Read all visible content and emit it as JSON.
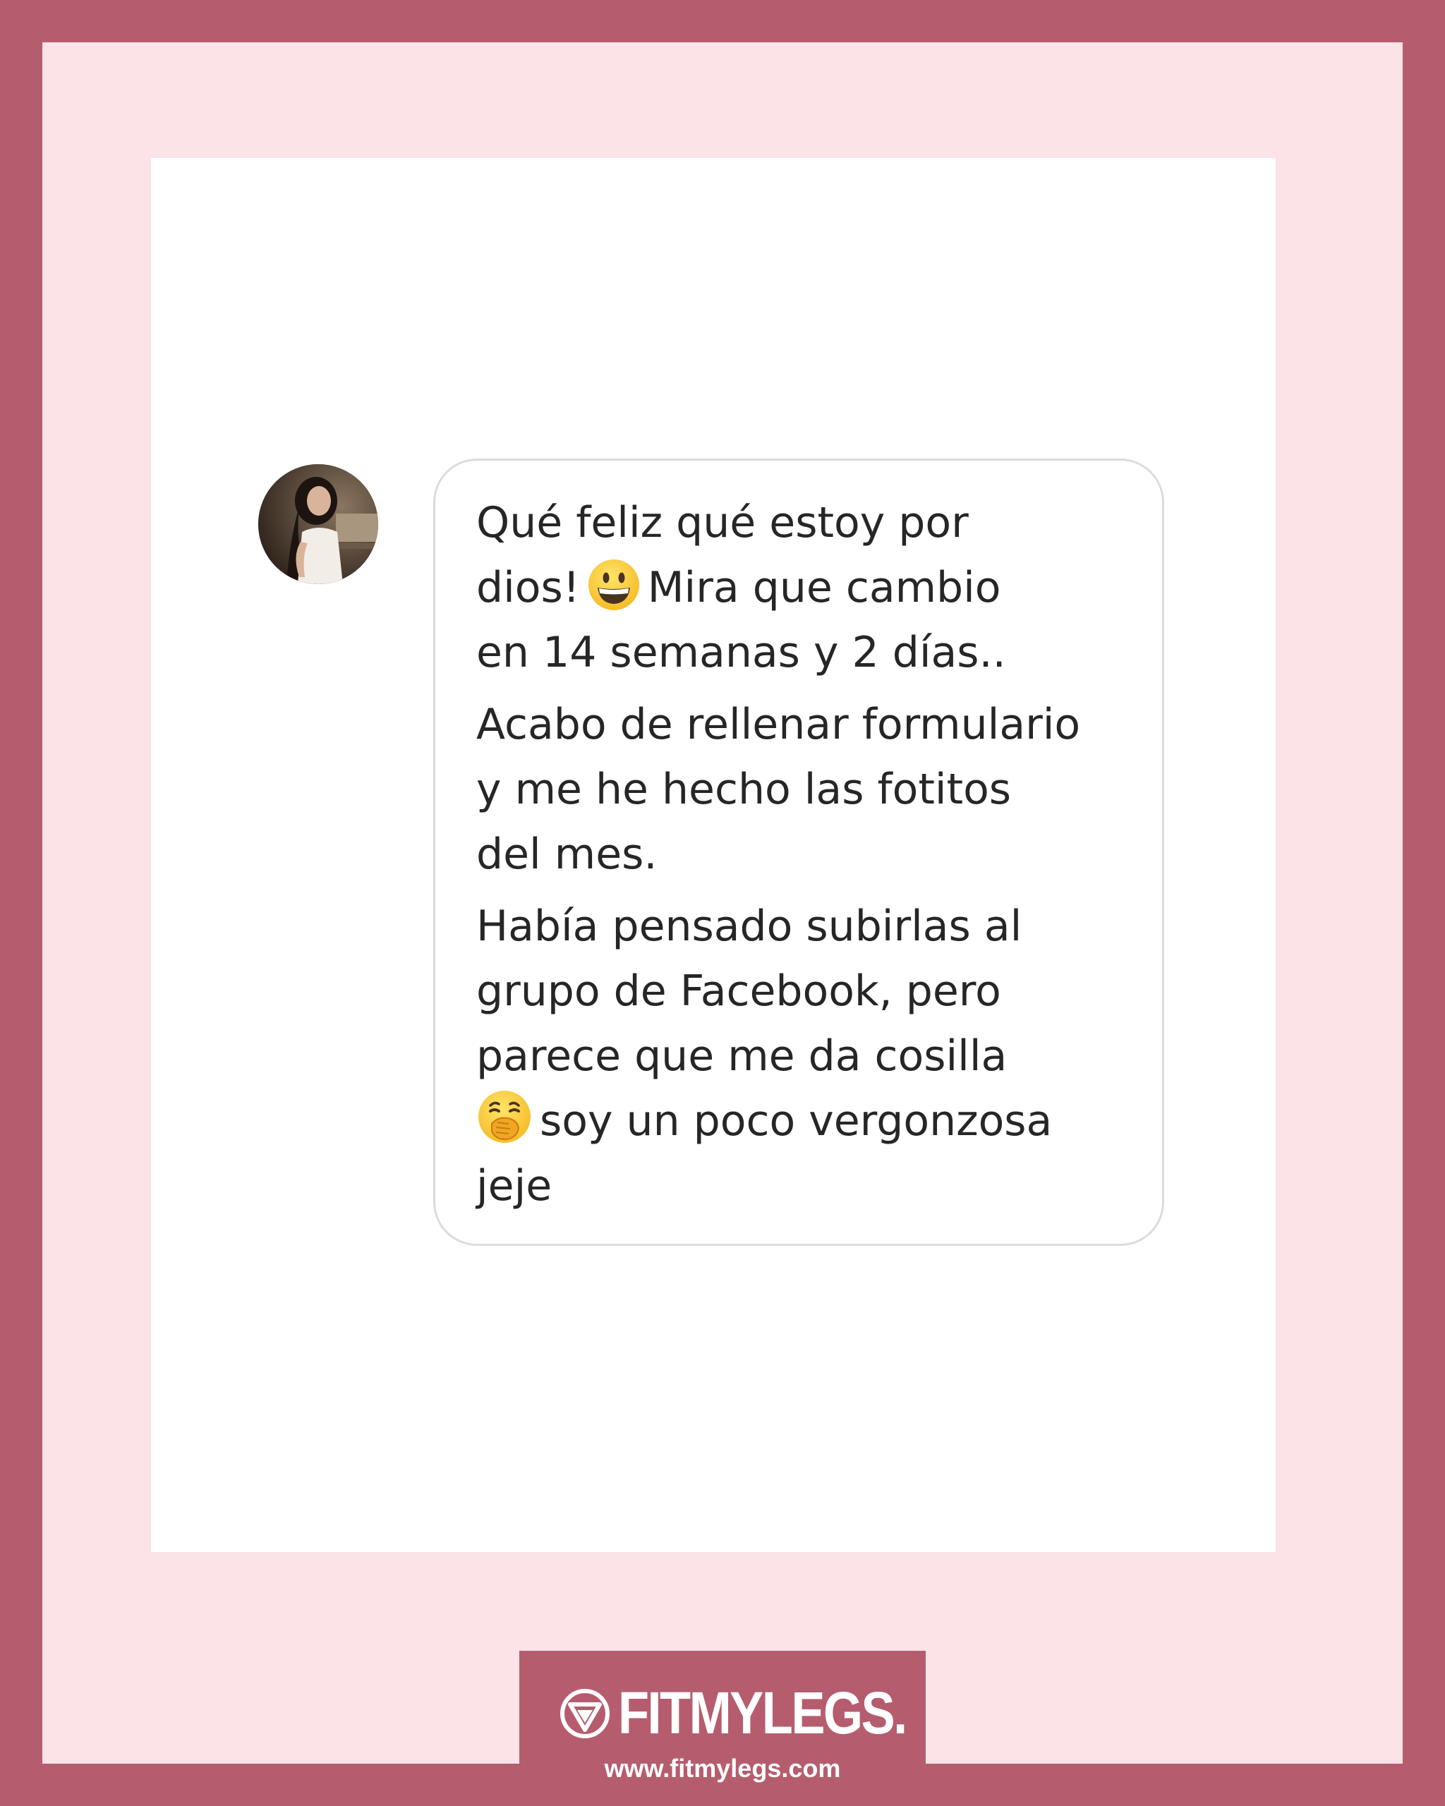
{
  "message": {
    "paragraphs": [
      {
        "lines": [
          {
            "before": "Qué feliz qué estoy por"
          },
          {
            "before": "dios!",
            "emoji": "grinning-face-emoji",
            "after": "Mira que cambio"
          },
          {
            "before": "en 14 semanas y 2 días.."
          }
        ]
      },
      {
        "lines": [
          {
            "before": "Acabo de rellenar formulario"
          },
          {
            "before": "y me he hecho las fotitos"
          },
          {
            "before": "del mes."
          }
        ]
      },
      {
        "lines": [
          {
            "before": "Había pensado subirlas al"
          },
          {
            "before": "grupo de Facebook, pero"
          },
          {
            "before": "parece que me da cosilla"
          },
          {
            "before": "",
            "emoji": "face-with-hand-over-mouth-emoji",
            "after": "soy un poco vergonzosa"
          },
          {
            "before": "jeje"
          }
        ]
      }
    ]
  },
  "avatar": {
    "icon": "user-avatar-photo"
  },
  "brand": {
    "name": "FITMYLEGS.",
    "url": "www.fitmylegs.com",
    "logo_icon": "fitmylegs-logo-icon"
  },
  "colors": {
    "frame": "#b55d6e",
    "panel": "#fbe3e8",
    "card": "#ffffff",
    "bubble_border": "#dcdcdc",
    "text": "#262626"
  }
}
